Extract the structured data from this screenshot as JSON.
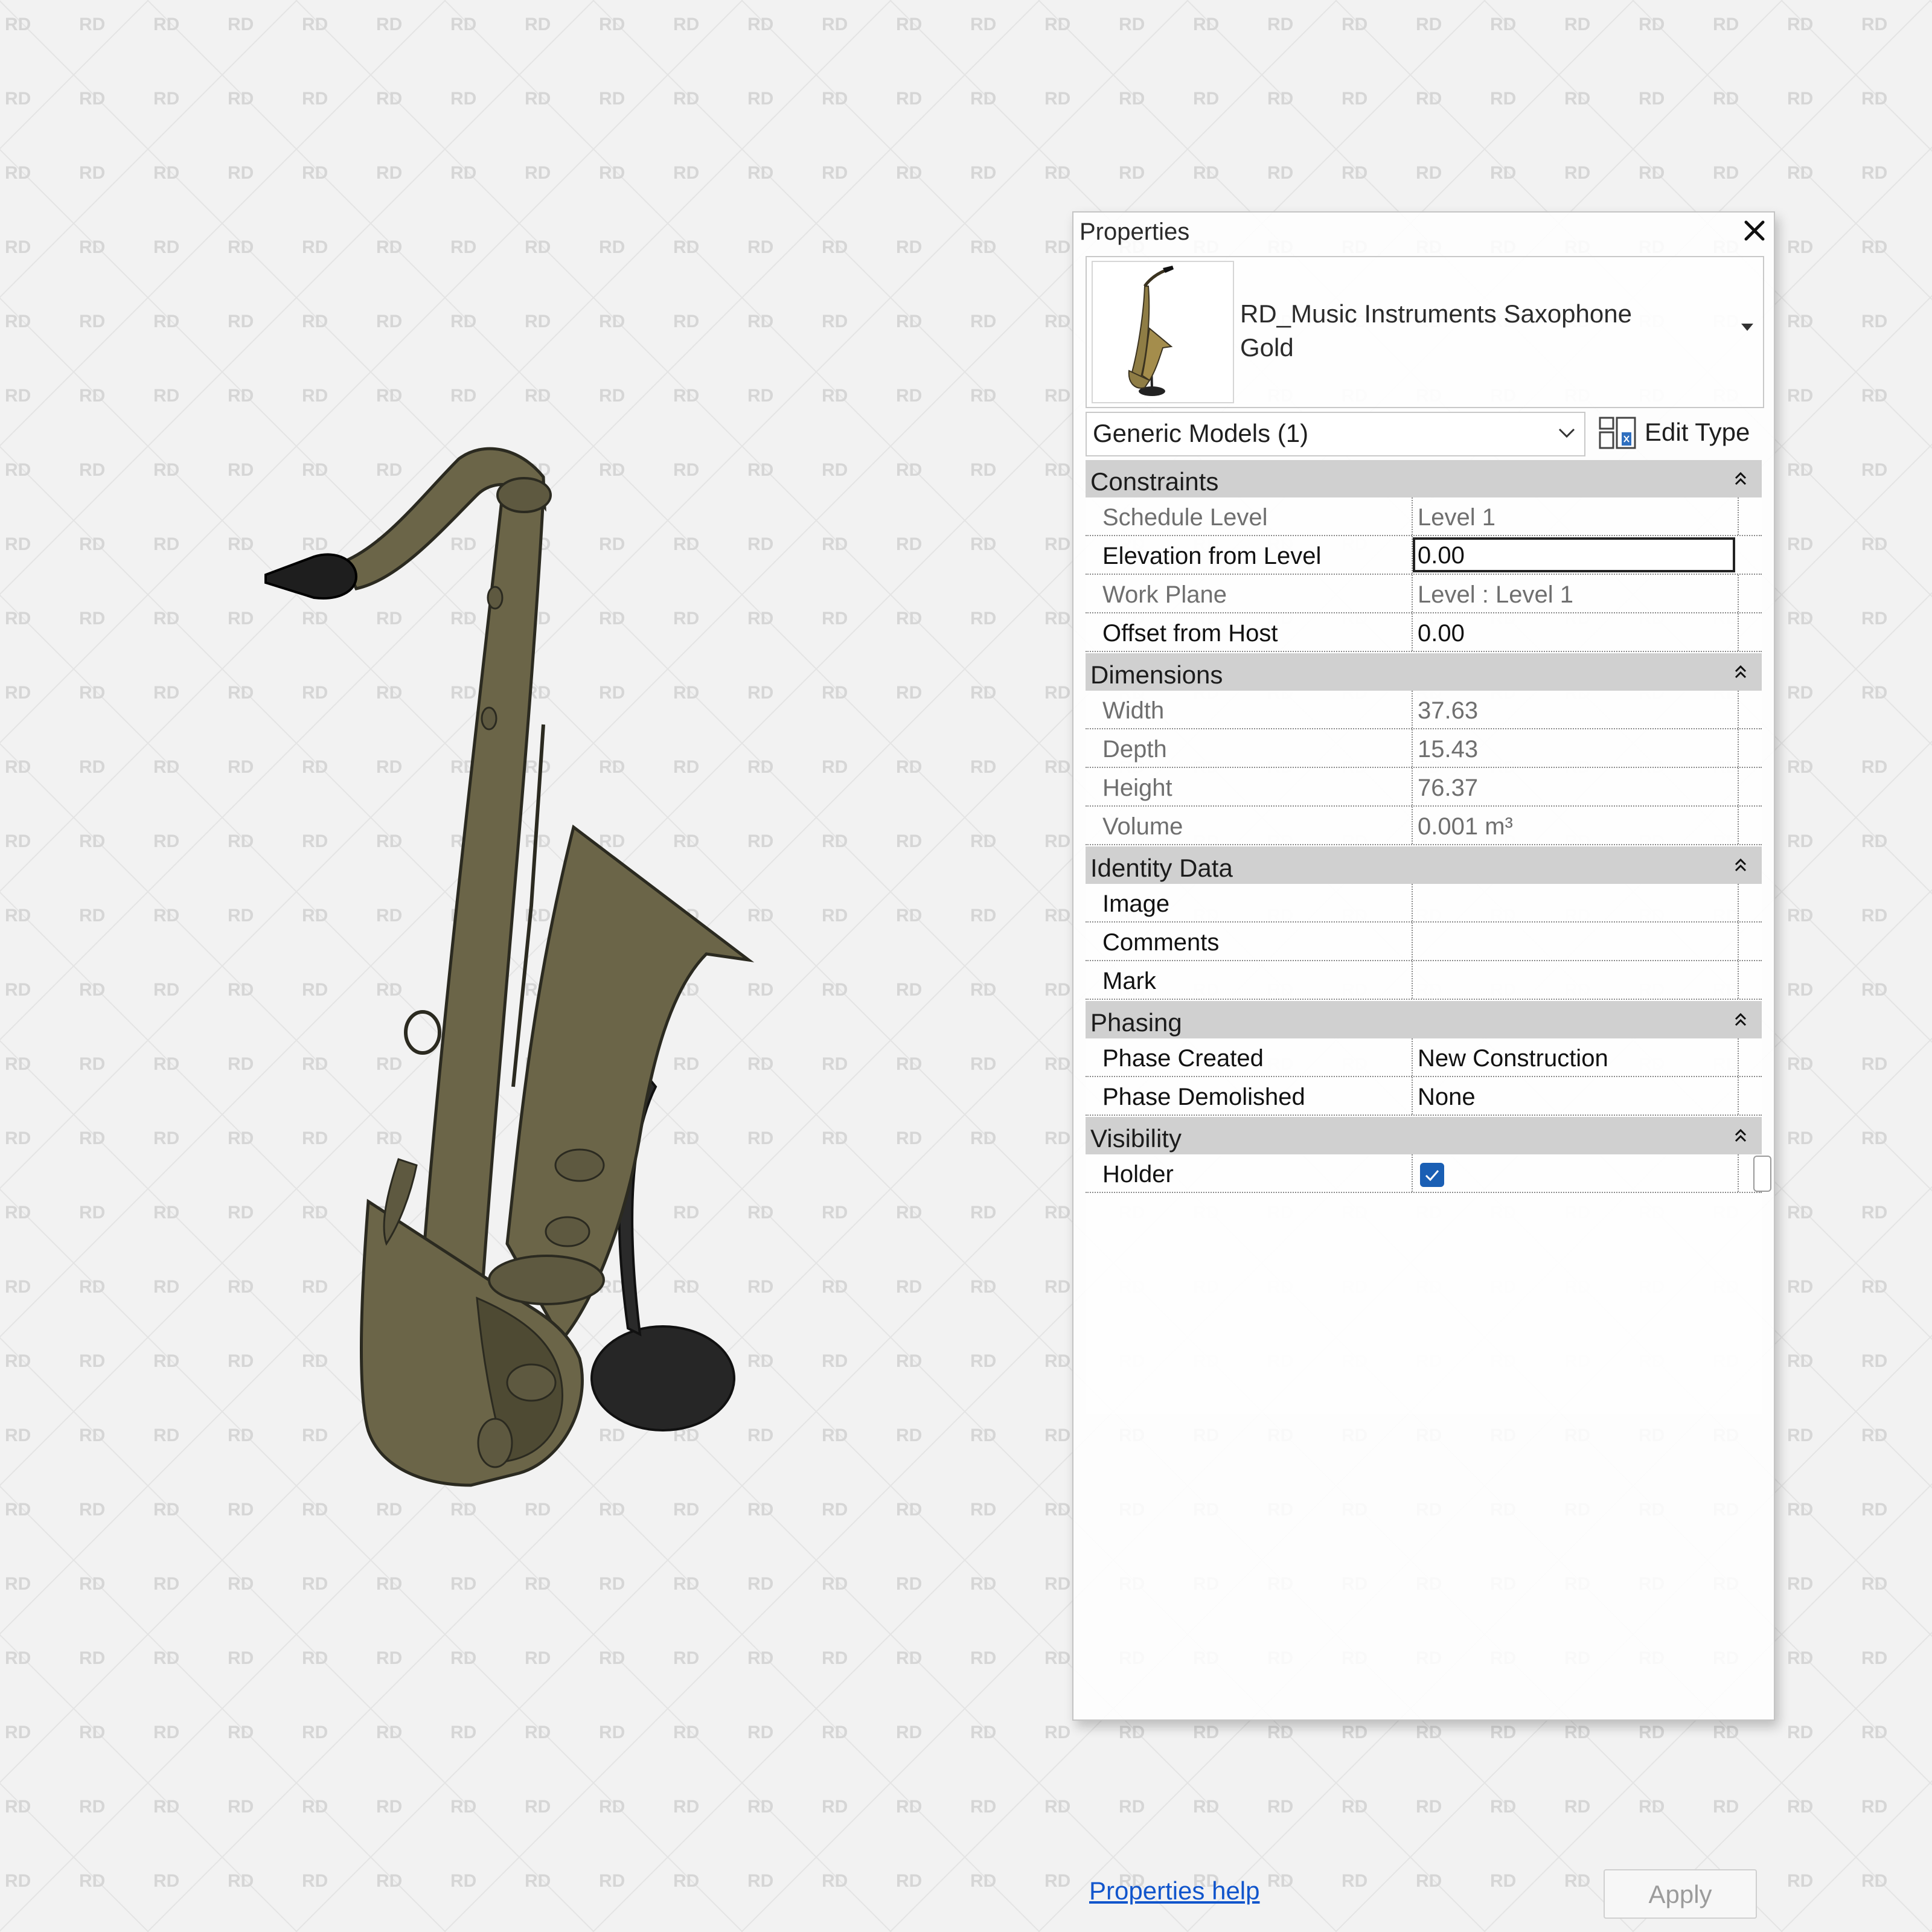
{
  "watermark": {
    "text": "RD"
  },
  "viewport": {
    "object": "saxophone-on-stand",
    "colors": {
      "body": "#6b6548",
      "body_dark": "#4e4a33",
      "outline": "#2b2a20",
      "stand": "#262626"
    }
  },
  "properties": {
    "title": "Properties",
    "type_selector": {
      "name_line1": "RD_Music Instruments Saxophone",
      "name_line2": "Gold"
    },
    "filter": {
      "selected": "Generic Models (1)"
    },
    "edit_type_label": "Edit Type",
    "groups": [
      {
        "label": "Constraints",
        "rows": [
          {
            "name": "Schedule Level",
            "value": "Level 1",
            "readonly": true
          },
          {
            "name": "Elevation from Level",
            "value": "0.00",
            "readonly": false,
            "editing": true
          },
          {
            "name": "Work Plane",
            "value": "Level : Level 1",
            "readonly": true
          },
          {
            "name": "Offset from Host",
            "value": "0.00",
            "readonly": false
          }
        ]
      },
      {
        "label": "Dimensions",
        "rows": [
          {
            "name": "Width",
            "value": "37.63",
            "readonly": true
          },
          {
            "name": "Depth",
            "value": "15.43",
            "readonly": true
          },
          {
            "name": "Height",
            "value": "76.37",
            "readonly": true
          },
          {
            "name": "Volume",
            "value": "0.001 m³",
            "readonly": true
          }
        ]
      },
      {
        "label": "Identity Data",
        "rows": [
          {
            "name": "Image",
            "value": "",
            "readonly": false
          },
          {
            "name": "Comments",
            "value": "",
            "readonly": false
          },
          {
            "name": "Mark",
            "value": "",
            "readonly": false
          }
        ]
      },
      {
        "label": "Phasing",
        "rows": [
          {
            "name": "Phase Created",
            "value": "New Construction",
            "readonly": false
          },
          {
            "name": "Phase Demolished",
            "value": "None",
            "readonly": false
          }
        ]
      },
      {
        "label": "Visibility",
        "rows": [
          {
            "name": "Holder",
            "checkbox": true,
            "checked": true,
            "readonly": false
          }
        ]
      }
    ],
    "help_link": "Properties help",
    "apply_label": "Apply",
    "colors": {
      "header_bg": "#c8c8c8",
      "checkbox": "#1a5fb4",
      "link": "#1155cc"
    }
  }
}
